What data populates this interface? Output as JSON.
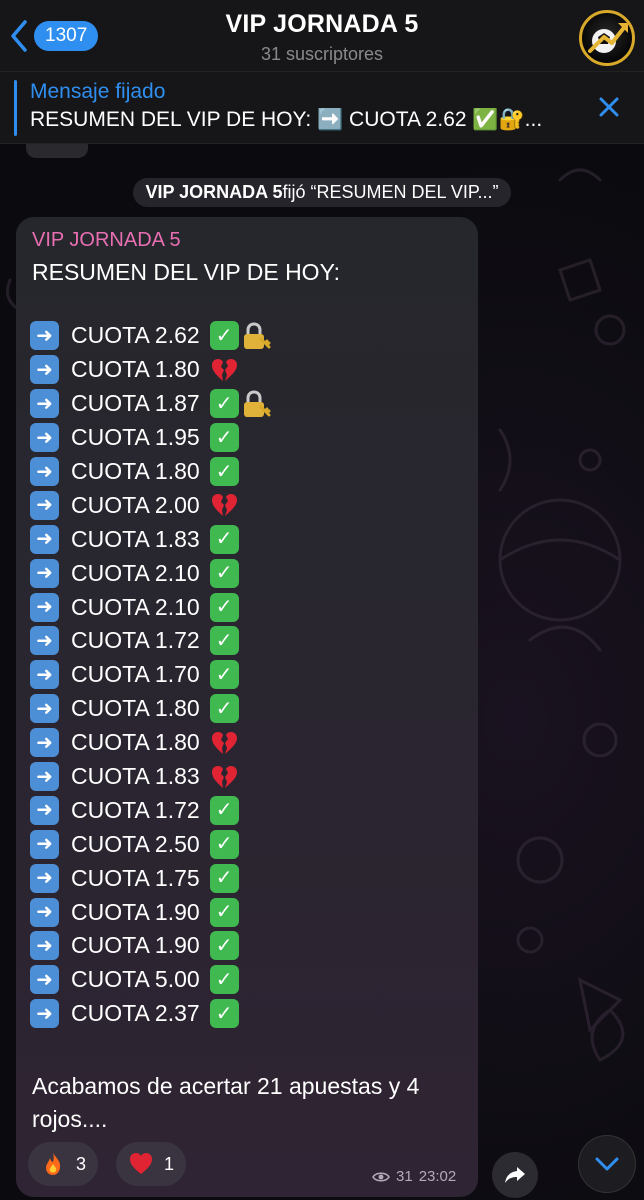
{
  "header": {
    "back_count": "1307",
    "title": "VIP JORNADA 5",
    "subtitle": "31 suscriptores",
    "avatar_icon": "ball-chart-logo"
  },
  "pinned": {
    "label": "Mensaje fijado",
    "text": "RESUMEN DEL VIP DE HOY: ➡️ CUOTA 2.62 ✅🔐..."
  },
  "service": {
    "actor": "VIP JORNADA 5",
    "action": " fijó “RESUMEN DEL VIP...”"
  },
  "message": {
    "sender": "VIP JORNADA 5",
    "heading": "RESUMEN DEL VIP DE HOY:",
    "lines": [
      {
        "text": "CUOTA 2.62",
        "result": "win",
        "locked": true
      },
      {
        "text": "CUOTA 1.80",
        "result": "loss",
        "locked": false
      },
      {
        "text": "CUOTA 1.87",
        "result": "win",
        "locked": true
      },
      {
        "text": "CUOTA 1.95",
        "result": "win",
        "locked": false
      },
      {
        "text": "CUOTA 1.80",
        "result": "win",
        "locked": false
      },
      {
        "text": "CUOTA 2.00",
        "result": "loss",
        "locked": false
      },
      {
        "text": "CUOTA 1.83",
        "result": "win",
        "locked": false
      },
      {
        "text": "CUOTA 2.10",
        "result": "win",
        "locked": false
      },
      {
        "text": "CUOTA 2.10",
        "result": "win",
        "locked": false
      },
      {
        "text": "CUOTA 1.72",
        "result": "win",
        "locked": false
      },
      {
        "text": "CUOTA 1.70",
        "result": "win",
        "locked": false
      },
      {
        "text": "CUOTA 1.80",
        "result": "win",
        "locked": false
      },
      {
        "text": "CUOTA 1.80",
        "result": "loss",
        "locked": false
      },
      {
        "text": "CUOTA 1.83",
        "result": "loss",
        "locked": false
      },
      {
        "text": "CUOTA 1.72",
        "result": "win",
        "locked": false
      },
      {
        "text": "CUOTA 2.50",
        "result": "win",
        "locked": false
      },
      {
        "text": "CUOTA 1.75",
        "result": "win",
        "locked": false
      },
      {
        "text": "CUOTA 1.90",
        "result": "win",
        "locked": false
      },
      {
        "text": "CUOTA 1.90",
        "result": "win",
        "locked": false
      },
      {
        "text": "CUOTA 5.00",
        "result": "win",
        "locked": false
      },
      {
        "text": "CUOTA 2.37",
        "result": "win",
        "locked": false
      }
    ],
    "closing": "Acabamos de acertar 21 apuestas y 4 rojos....",
    "reactions": [
      {
        "emoji": "fire",
        "count": "3"
      },
      {
        "emoji": "heart",
        "count": "1"
      }
    ],
    "views": "31",
    "time": "23:02"
  },
  "colors": {
    "accent": "#2f8ff0",
    "sender": "#e86fb2",
    "win": "#3fb950",
    "arrow": "#4d8fd6"
  }
}
